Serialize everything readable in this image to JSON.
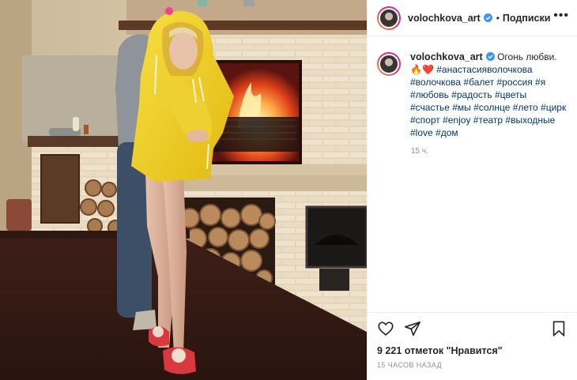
{
  "post": {
    "username": "volochkova_art",
    "follow_label": "Подписки",
    "dot": "•",
    "more": "•••",
    "caption_text": "Огонь любви.🔥❤️",
    "hashtags": "#анастасияволочкова #волочкова #балет #россия #я #любовь #радость #цветы #счастье #мы #солнце #лето #цирк #спорт #enjoy #театр #выходные #love #дом",
    "caption_time": "15 ч.",
    "likes": "9 221 отметок \"Нравится\"",
    "posted_ago": "15 ЧАСОВ НАЗАД"
  },
  "icons": {
    "verified": "verified-badge-icon",
    "like": "heart-icon",
    "share": "paper-plane-icon",
    "save": "bookmark-icon",
    "more": "more-options-icon"
  },
  "colors": {
    "verified_blue": "#3897f0",
    "hashtag_blue": "#00376b",
    "muted_text": "#8e8e8e",
    "hoodie_yellow": "#f2d21a"
  }
}
